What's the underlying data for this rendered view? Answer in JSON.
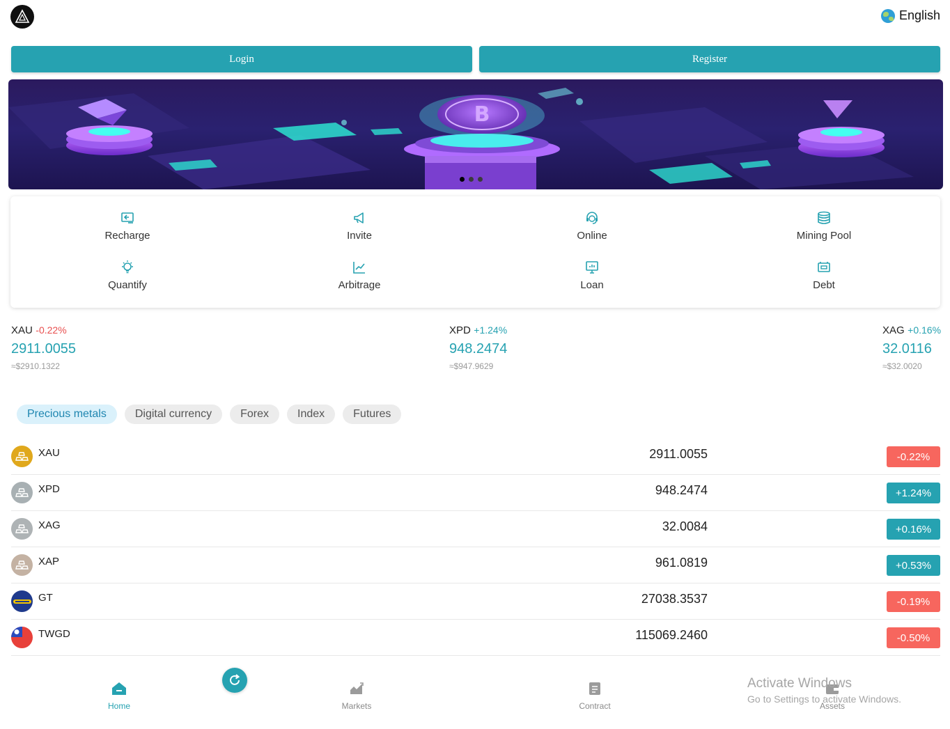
{
  "header": {
    "logo_icon": "triangle-logo-icon",
    "language": "English",
    "globe_icon": "globe-icon"
  },
  "auth": {
    "login_label": "Login",
    "register_label": "Register"
  },
  "banner": {
    "slides_total": 3,
    "active_slide": 1
  },
  "quick_menu": {
    "items": [
      {
        "label": "Recharge",
        "icon": "recharge-icon"
      },
      {
        "label": "Invite",
        "icon": "megaphone-icon"
      },
      {
        "label": "Online",
        "icon": "headset-icon"
      },
      {
        "label": "Mining Pool",
        "icon": "database-icon"
      },
      {
        "label": "Quantify",
        "icon": "lightbulb-icon"
      },
      {
        "label": "Arbitrage",
        "icon": "chart-icon"
      },
      {
        "label": "Loan",
        "icon": "monitor-icon"
      },
      {
        "label": "Debt",
        "icon": "ticket-icon"
      }
    ]
  },
  "ticker": [
    {
      "symbol": "XAU",
      "change": "-0.22%",
      "price": "2911.0055",
      "usd": "≈$2910.1322"
    },
    {
      "symbol": "XPD",
      "change": "+1.24%",
      "price": "948.2474",
      "usd": "≈$947.9629"
    },
    {
      "symbol": "XAG",
      "change": "+0.16%",
      "price": "32.0116",
      "usd": "≈$32.0020"
    }
  ],
  "tabs": [
    {
      "label": "Precious metals",
      "active": true
    },
    {
      "label": "Digital currency",
      "active": false
    },
    {
      "label": "Forex",
      "active": false
    },
    {
      "label": "Index",
      "active": false
    },
    {
      "label": "Futures",
      "active": false
    }
  ],
  "market_list": [
    {
      "symbol": "XAU",
      "price": "2911.0055",
      "change": "-0.22%",
      "icon": "gold-bars-icon"
    },
    {
      "symbol": "XPD",
      "price": "948.2474",
      "change": "+1.24%",
      "icon": "palladium-bars-icon"
    },
    {
      "symbol": "XAG",
      "price": "32.0084",
      "change": "+0.16%",
      "icon": "silver-bars-icon"
    },
    {
      "symbol": "XAP",
      "price": "961.0819",
      "change": "+0.53%",
      "icon": "platinum-bars-icon"
    },
    {
      "symbol": "GT",
      "price": "27038.3537",
      "change": "-0.19%",
      "icon": "goodyear-logo-icon"
    },
    {
      "symbol": "TWGD",
      "price": "115069.2460",
      "change": "-0.50%",
      "icon": "taiwan-flag-icon"
    }
  ],
  "bottom_nav": {
    "home": "Home",
    "markets": "Markets",
    "contract": "Contract",
    "assets": "Assets",
    "refresh_icon": "refresh-icon"
  },
  "watermark": {
    "line1": "Activate Windows",
    "line2": "Go to Settings to activate Windows."
  },
  "colors": {
    "accent": "#26a2b1",
    "negative": "#f7665e",
    "positive": "#26a2b1"
  }
}
